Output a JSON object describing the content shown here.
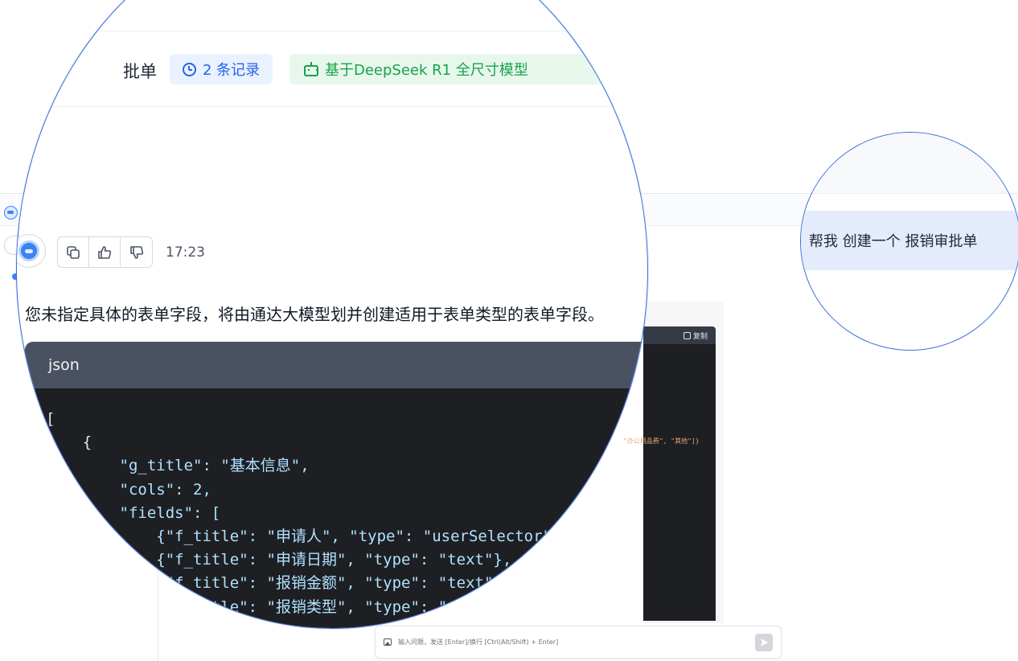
{
  "app": {
    "short_name": "通达"
  },
  "header": {
    "title_fragment": "批单",
    "records_badge": "2 条记录",
    "model_badge": "基于DeepSeek R1 全尺寸模型"
  },
  "message": {
    "time": "17:23",
    "actions": [
      "copy",
      "thumbs-up",
      "thumbs-down"
    ],
    "answer": "您未指定具体的表单字段，将由通达大模型划并创建适用于表单类型的表单字段。"
  },
  "code_block": {
    "lang": "json",
    "copy_label": "复制",
    "fragment_right": "\"办公用品费\", \"其他\"]}",
    "lines": [
      "[",
      "    {",
      "        \"g_title\": \"基本信息\",",
      "        \"cols\": 2,",
      "        \"fields\": [",
      "            {\"f_title\": \"申请人\", \"type\": \"userSelector\"},",
      "            {\"f_title\": \"申请日期\", \"type\": \"text\"},",
      "            {\"f_title\": \"报销金额\", \"type\": \"text\"},",
      "            {\"f_title\": \"报销类型\", \"type\": \"select\","
    ]
  },
  "user_message": "帮我 创建一个 报销审批单",
  "input": {
    "placeholder": "输入问题，发送 [Enter]/换行 [Ctrl(Alt/Shift) + Enter]"
  },
  "colors": {
    "accent_blue": "#2563eb",
    "accent_green": "#16a34a",
    "code_bg": "#1e1f23",
    "code_head_bg": "#4a5161",
    "user_bubble_bg": "#e3ebfc"
  }
}
